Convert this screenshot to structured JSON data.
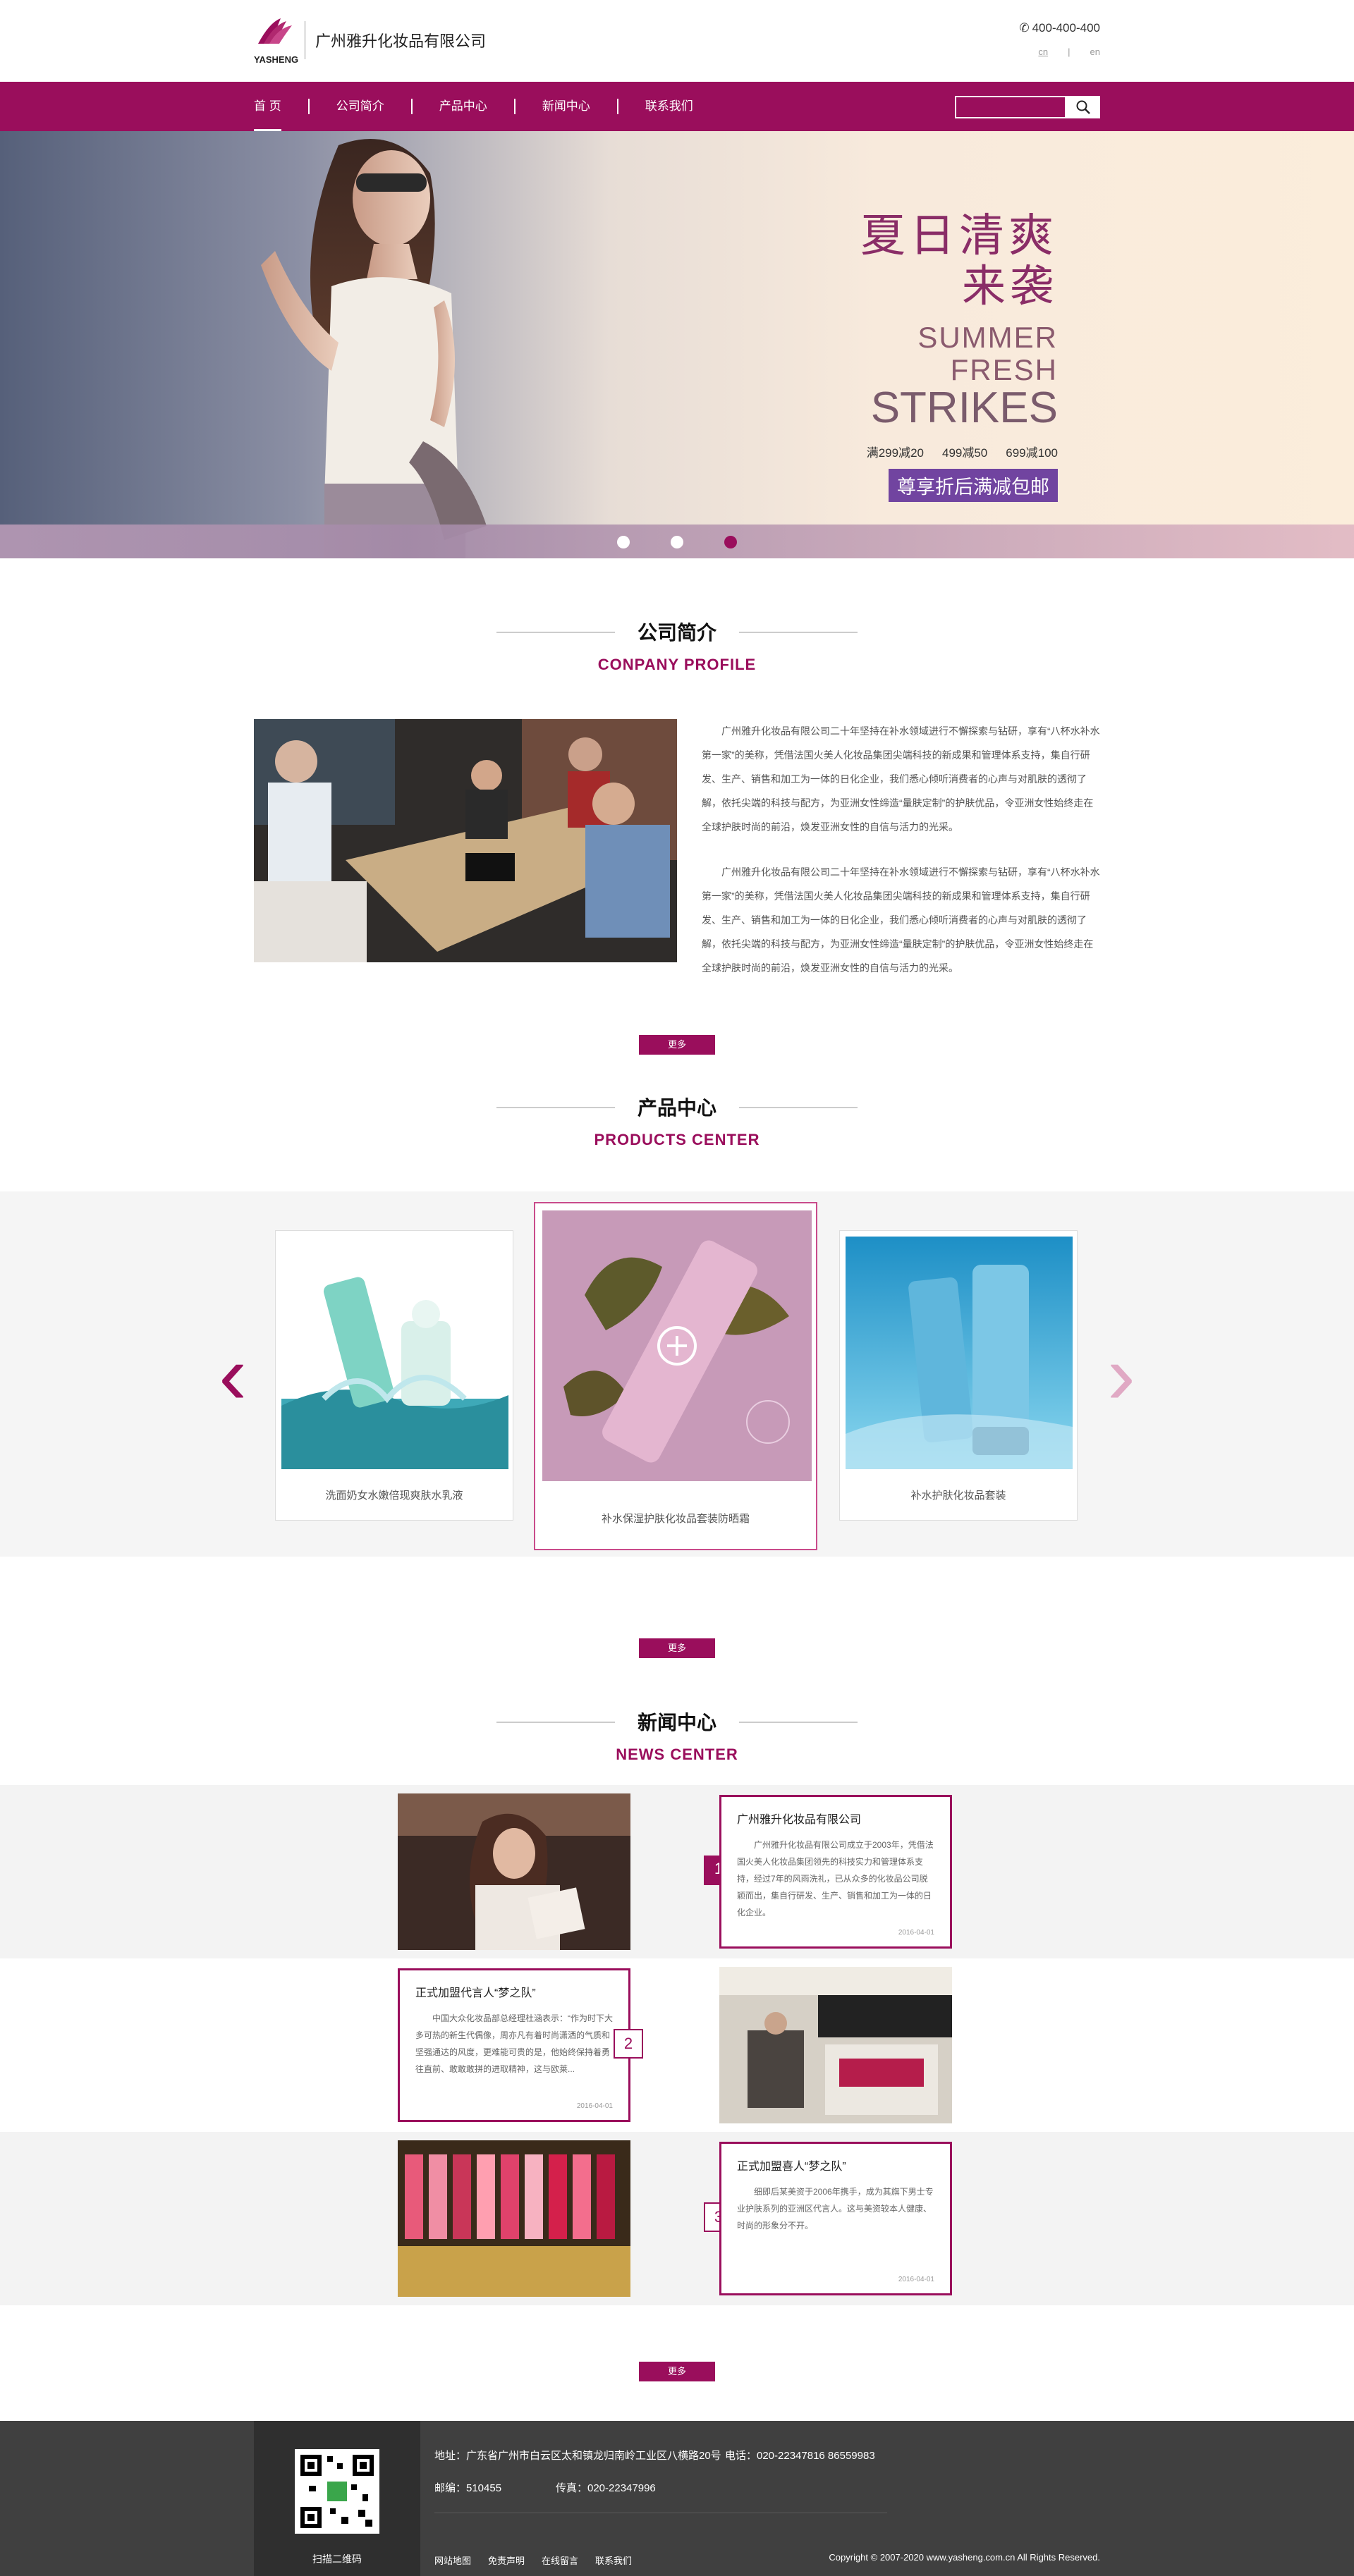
{
  "header": {
    "logo_en": "YASHENG",
    "company_name": "广州雅升化妆品有限公司",
    "hotline": "400-400-400",
    "lang_cn": "cn",
    "lang_sep": "|",
    "lang_en": "en"
  },
  "nav": {
    "items": [
      "首 页",
      "公司简介",
      "产品中心",
      "新闻中心",
      "联系我们"
    ],
    "search_placeholder": ""
  },
  "banner": {
    "line1": "夏日清爽",
    "line2": "来袭",
    "line3": "SUMMER",
    "line4": "FRESH",
    "line5": "STRIKES",
    "promos": [
      "满299减20",
      "499减50",
      "699减100"
    ],
    "cta": "尊享折后满减包邮",
    "slides": 3,
    "active_slide": 3
  },
  "about": {
    "title_cn": "公司简介",
    "title_en": "CONPANY PROFILE",
    "paragraph1": "广州雅升化妆品有限公司二十年坚持在补水领域进行不懈探索与钻研，享有“八杯水补水第一家”的美称，凭借法国火美人化妆品集团尖端科技的新成果和管理体系支持，集自行研发、生产、销售和加工为一体的日化企业，我们悉心倾听消费者的心声与对肌肤的透彻了解，依托尖端的科技与配方，为亚洲女性缔造“量肤定制”的护肤优品，令亚洲女性始终走在全球护肤时尚的前沿，焕发亚洲女性的自信与活力的光采。",
    "paragraph2": "广州雅升化妆品有限公司二十年坚持在补水领域进行不懈探索与钻研，享有“八杯水补水第一家”的美称，凭借法国火美人化妆品集团尖端科技的新成果和管理体系支持，集自行研发、生产、销售和加工为一体的日化企业，我们悉心倾听消费者的心声与对肌肤的透彻了解，依托尖端的科技与配方，为亚洲女性缔造“量肤定制”的护肤优品，令亚洲女性始终走在全球护肤时尚的前沿，焕发亚洲女性的自信与活力的光采。",
    "more": "更多"
  },
  "products": {
    "title_cn": "产品中心",
    "title_en": "PRODUCTS CENTER",
    "items": [
      "洗面奶女水嫩倍现爽肤水乳液",
      "补水保湿护肤化妆品套装防晒霜",
      "补水护肤化妆品套装"
    ],
    "more": "更多"
  },
  "news": {
    "title_cn": "新闻中心",
    "title_en": "NEWS CENTER",
    "items": [
      {
        "num": "1",
        "title": "广州雅升化妆品有限公司",
        "desc": "广州雅升化妆品有限公司成立于2003年，凭借法国火美人化妆品集团领先的科技实力和管理体系支持，经过7年的风雨洗礼，已从众多的化妆品公司脱颖而出，集自行研发、生产、销售和加工为一体的日化企业。",
        "date": "2016-04-01"
      },
      {
        "num": "2",
        "title": "正式加盟代言人“梦之队”",
        "desc": "中国大众化妆品部总经理杜涵表示：“作为时下大多可热的新生代偶像，周亦凡有着时尚潇洒的气质和坚强通达的风度，更难能可贵的是，他始终保持着勇往直前、敢敢敢拼的进取精神，这与欧莱...",
        "date": "2016-04-01"
      },
      {
        "num": "3",
        "title": "正式加盟喜人“梦之队”",
        "desc": "细即后某美资于2006年携手，成为其旗下男士专业护肤系列的亚洲区代言人。这与美资较本人健康、时尚的形象分不开。",
        "date": "2016-04-01"
      }
    ],
    "more": "更多"
  },
  "footer": {
    "qr_label": "扫描二维码",
    "address": "地址：广东省广州市白云区太和镇龙归南岭工业区八横路20号",
    "phone": "电话：020-22347816  86559983",
    "postcode": "邮编：510455",
    "fax": "传真：020-22347996",
    "links": [
      "网站地图",
      "免责声明",
      "在线留言",
      "联系我们"
    ],
    "copyright": "Copyright  ©  2007-2020 www.yasheng.com.cn All Rights Reserved."
  },
  "colors": {
    "brand": "#9a0e5c",
    "banner_cta": "#7144a0",
    "footer": "#404040"
  }
}
